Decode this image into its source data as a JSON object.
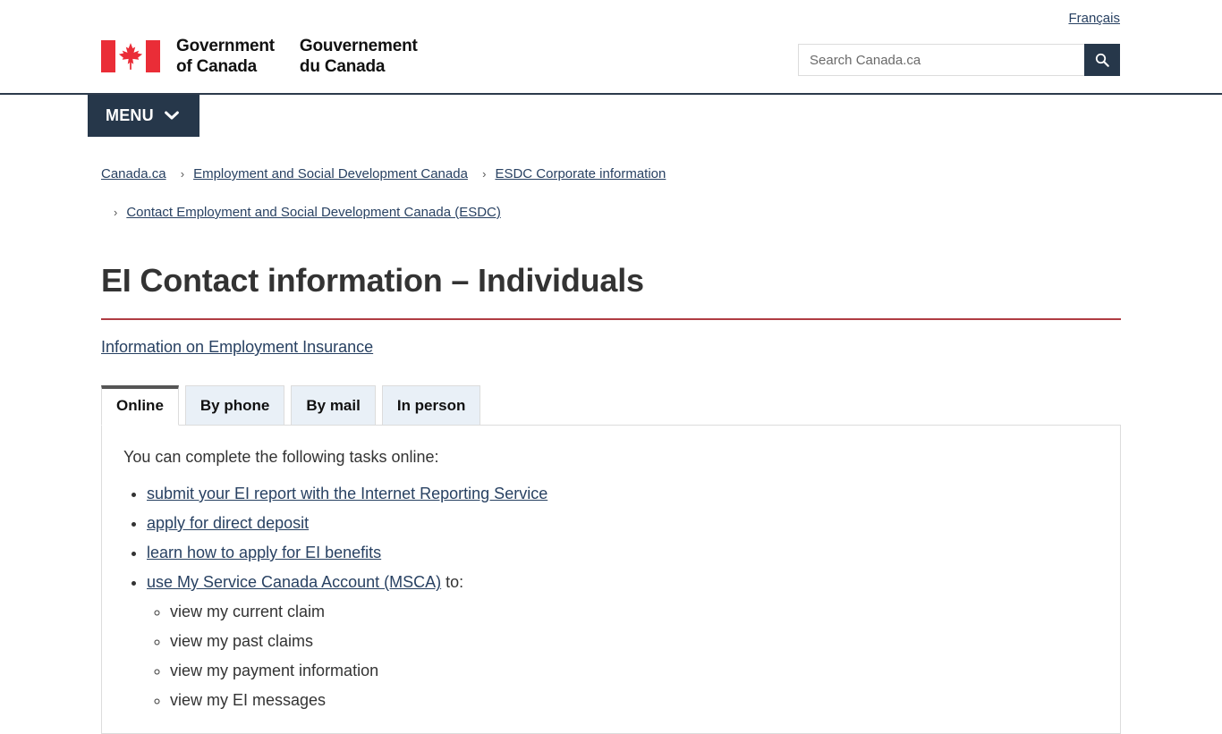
{
  "header": {
    "lang_toggle": "Français",
    "wordmark_en_line1": "Government",
    "wordmark_en_line2": "of Canada",
    "wordmark_fr_line1": "Gouvernement",
    "wordmark_fr_line2": "du Canada",
    "flag_icon": "canada-flag-icon",
    "search": {
      "placeholder": "Search Canada.ca",
      "value": "",
      "button_icon": "search-icon"
    },
    "menu": {
      "label": "MENU",
      "chevron_icon": "chevron-down-icon"
    },
    "colors": {
      "navy": "#26374A",
      "flag_red": "#EA2D37",
      "accent_red": "#AF3C43",
      "link": "#284162"
    }
  },
  "breadcrumb": {
    "separator": "›",
    "items": [
      "Canada.ca",
      "Employment and Social Development Canada",
      "ESDC Corporate information",
      "Contact Employment and Social Development Canada (ESDC)"
    ]
  },
  "main": {
    "title": "EI Contact information – Individuals",
    "intro_link": "Information on Employment Insurance",
    "tabs": [
      {
        "label": "Online",
        "active": true
      },
      {
        "label": "By phone",
        "active": false
      },
      {
        "label": "By mail",
        "active": false
      },
      {
        "label": "In person",
        "active": false
      }
    ],
    "panel": {
      "intro": "You can complete the following tasks online:",
      "items": [
        {
          "link": "submit your EI report with the Internet Reporting Service",
          "suffix": ""
        },
        {
          "link": "apply for direct deposit",
          "suffix": ""
        },
        {
          "link": "learn how to apply for EI benefits",
          "suffix": ""
        },
        {
          "link": "use My Service Canada Account (MSCA)",
          "suffix": " to:"
        }
      ],
      "sub_items": [
        "view my current claim",
        "view my past claims",
        "view my payment information",
        "view my EI messages"
      ]
    }
  }
}
